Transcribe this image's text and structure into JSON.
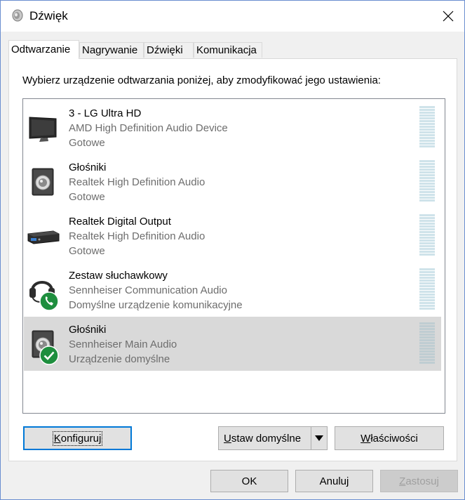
{
  "window": {
    "title": "Dźwięk"
  },
  "tabs": [
    {
      "label": "Odtwarzanie",
      "active": true
    },
    {
      "label": "Nagrywanie",
      "active": false
    },
    {
      "label": "Dźwięki",
      "active": false
    },
    {
      "label": "Komunikacja",
      "active": false
    }
  ],
  "instruction": "Wybierz urządzenie odtwarzania poniżej, aby zmodyfikować jego ustawienia:",
  "devices": [
    {
      "name": "3 - LG Ultra HD",
      "description": "AMD High Definition Audio Device",
      "status": "Gotowe",
      "icon": "monitor-icon",
      "badge": null,
      "selected": false
    },
    {
      "name": "Głośniki",
      "description": "Realtek High Definition Audio",
      "status": "Gotowe",
      "icon": "speaker-icon",
      "badge": null,
      "selected": false
    },
    {
      "name": "Realtek Digital Output",
      "description": "Realtek High Definition Audio",
      "status": "Gotowe",
      "icon": "digital-output-icon",
      "badge": null,
      "selected": false
    },
    {
      "name": "Zestaw słuchawkowy",
      "description": "Sennheiser Communication Audio",
      "status": "Domyślne urządzenie komunikacyjne",
      "icon": "headset-icon",
      "badge": "phone-badge-icon",
      "selected": false
    },
    {
      "name": "Głośniki",
      "description": "Sennheiser Main Audio",
      "status": "Urządzenie domyślne",
      "icon": "speaker-icon",
      "badge": "checkmark-badge-icon",
      "selected": true
    }
  ],
  "buttons": {
    "configure": {
      "pre": "",
      "key": "K",
      "post": "onfiguruj"
    },
    "set_default": {
      "pre": "",
      "key": "U",
      "post": "staw domyślne"
    },
    "properties": {
      "pre": "",
      "key": "W",
      "post": "łaściwości"
    },
    "ok": "OK",
    "cancel": "Anuluj",
    "apply": {
      "pre": "",
      "key": "Z",
      "post": "astosuj"
    }
  },
  "colors": {
    "accent": "#0078d7",
    "selected_row": "#d9d9d9",
    "secondary_text": "#6d6d6d",
    "badge_green": "#1e8e3e"
  }
}
